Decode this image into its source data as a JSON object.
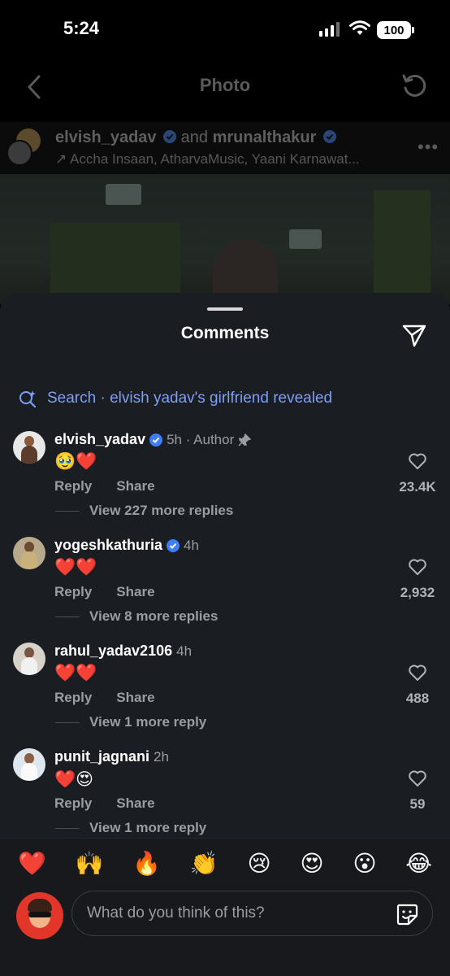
{
  "status_bar": {
    "time": "5:24",
    "battery": "100"
  },
  "header": {
    "title": "Photo"
  },
  "post": {
    "user1": "elvish_yadav",
    "and": " and ",
    "user2": "mrunalthakur",
    "music": "↗ Accha Insaan, AtharvaMusic, Yaani Karnawat...",
    "more": "•••"
  },
  "sheet": {
    "title": "Comments",
    "search": "Search · elvish yadav's girlfriend revealed"
  },
  "comments": [
    {
      "user": "elvish_yadav",
      "verified": true,
      "meta": "5h · Author",
      "pinned": true,
      "emojis": "🥹❤️",
      "reply": "Reply",
      "share": "Share",
      "likes": "23.4K",
      "view_replies": "View 227 more replies"
    },
    {
      "user": "yogeshkathuria",
      "verified": true,
      "meta": "4h",
      "pinned": false,
      "emojis": "❤️❤️",
      "reply": "Reply",
      "share": "Share",
      "likes": "2,932",
      "view_replies": "View 8 more replies"
    },
    {
      "user": "rahul_yadav2106",
      "verified": false,
      "meta": "4h",
      "pinned": false,
      "emojis": "❤️❤️",
      "reply": "Reply",
      "share": "Share",
      "likes": "488",
      "view_replies": "View 1 more reply"
    },
    {
      "user": "punit_jagnani",
      "verified": false,
      "meta": "2h",
      "pinned": false,
      "emojis": "❤️😍",
      "reply": "Reply",
      "share": "Share",
      "likes": "59",
      "view_replies": "View 1 more reply"
    }
  ],
  "quick_reactions": [
    "❤️",
    "🙌",
    "🔥",
    "👏",
    "😢",
    "😍",
    "😮",
    "😂"
  ],
  "composer": {
    "placeholder": "What do you think of this?"
  },
  "colors": {
    "sheet_bg": "#1a1d21",
    "accent_link": "#7f9ef7",
    "verified": "#3d7df5"
  }
}
